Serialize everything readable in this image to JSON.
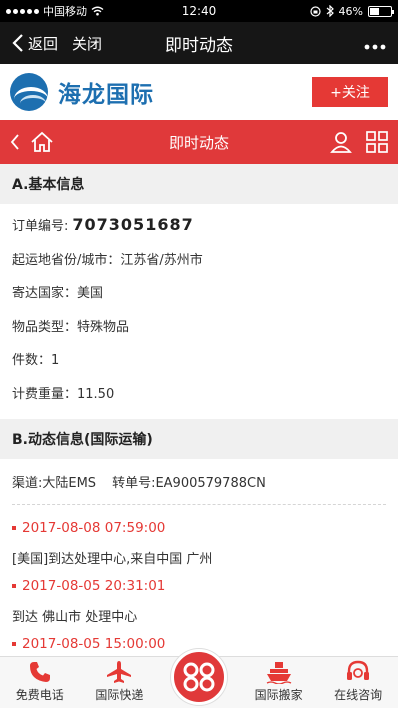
{
  "status_bar": {
    "carrier": "中国移动",
    "time": "12:40",
    "battery": "46%",
    "battery_level": 0.46
  },
  "nav": {
    "back_label": "返回",
    "close_label": "关闭",
    "title": "即时动态",
    "more_icon": "more-dots-icon"
  },
  "brand": {
    "name": "海龙国际",
    "follow_label": "+关注",
    "accent_color": "#e53935",
    "brand_color": "#1d6fb0"
  },
  "page_header": {
    "title": "即时动态"
  },
  "basic_info": {
    "heading": "A.基本信息",
    "order_label": "订单编号:",
    "order_number": "7073051687",
    "origin": "起运地省份/城市：江苏省/苏州市",
    "destination": "寄达国家：美国",
    "item_type": "物品类型：特殊物品",
    "pieces": "件数：1",
    "weight": "计费重量：11.50"
  },
  "tracking": {
    "heading": "B.动态信息(国际运输)",
    "channel": "渠道:大陆EMS",
    "transfer_no": "转单号:EA900579788CN",
    "events": [
      {
        "time": "2017-08-08 07:59:00",
        "desc": "[美国]到达处理中心,来自中国 广州"
      },
      {
        "time": "2017-08-05 20:31:01",
        "desc": "到达 佛山市 处理中心"
      },
      {
        "time": "2017-08-05 15:00:00",
        "desc": ""
      }
    ]
  },
  "tabbar": {
    "items": [
      {
        "label": "免费电话",
        "icon": "phone-icon"
      },
      {
        "label": "国际快递",
        "icon": "airplane-icon"
      },
      {
        "label": "",
        "icon": "center-logo-icon"
      },
      {
        "label": "国际搬家",
        "icon": "ship-icon"
      },
      {
        "label": "在线咨询",
        "icon": "headset-icon"
      }
    ]
  }
}
